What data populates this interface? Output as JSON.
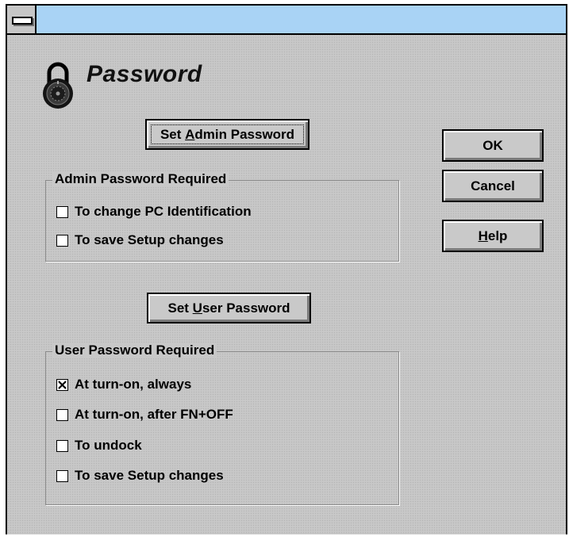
{
  "dialog": {
    "title": "Password",
    "icons": {
      "system_menu": "system-menu-icon",
      "lock": "padlock-icon",
      "check": "x-checkmark"
    }
  },
  "admin": {
    "set_button": {
      "pre": "Set ",
      "accel": "A",
      "post": "dmin Password"
    },
    "group_label": "Admin Password Required",
    "options": [
      {
        "label": "To change PC Identification",
        "checked": false
      },
      {
        "label": "To save Setup changes",
        "checked": false
      }
    ]
  },
  "user": {
    "set_button": {
      "pre": "Set ",
      "accel": "U",
      "post": "ser Password"
    },
    "group_label": "User Password Required",
    "options": [
      {
        "label": "At turn-on, always",
        "checked": true
      },
      {
        "label": "At turn-on, after FN+OFF",
        "checked": false
      },
      {
        "label": "To undock",
        "checked": false
      },
      {
        "label": "To save Setup changes",
        "checked": false
      }
    ]
  },
  "actions": {
    "ok": "OK",
    "cancel": "Cancel",
    "help": {
      "accel": "H",
      "post": "elp"
    }
  }
}
